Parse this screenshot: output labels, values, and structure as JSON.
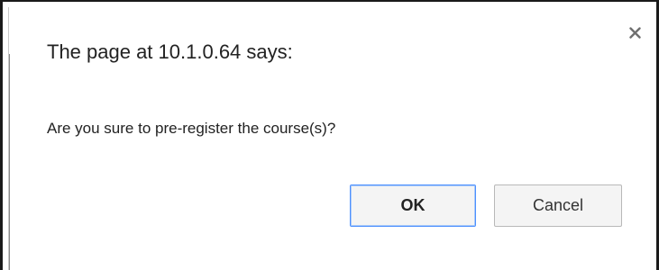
{
  "dialog": {
    "title": "The page at 10.1.0.64 says:",
    "message": "Are you sure to pre-register the course(s)?",
    "close_icon": "close-icon",
    "ok_label": "OK",
    "cancel_label": "Cancel"
  },
  "colors": {
    "background": "#ffffff",
    "text": "#222222",
    "button_background": "#f4f4f4",
    "button_border": "#b8b8b8",
    "focus_border": "#4d90fe"
  }
}
